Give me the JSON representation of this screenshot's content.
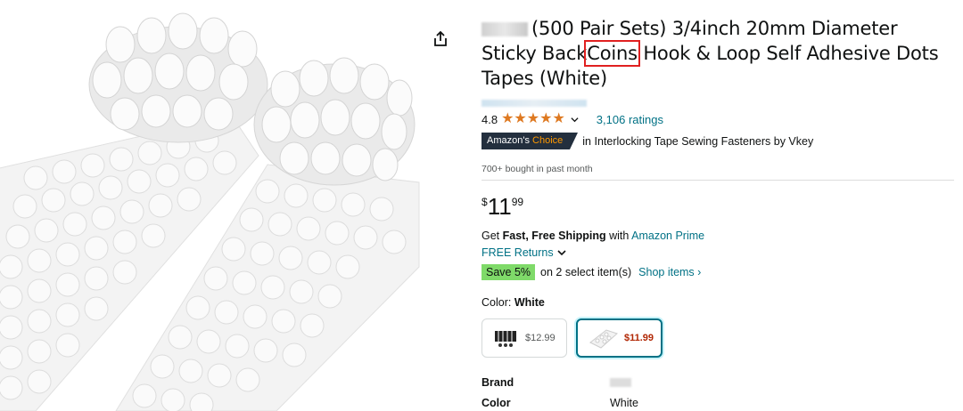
{
  "product": {
    "title": "(500 Pair Sets) 3/4inch 20mm Diameter Sticky Back",
    "title_highlight": "Coins",
    "title_rest": "Hook & Loop Self Adhesive Dots Tapes (White)",
    "rating": "4.8",
    "ratings_count": "3,106 ratings",
    "choice_badge_prefix": "Amazon's",
    "choice_badge_suffix": "Choice",
    "choice_category": "in Interlocking Tape Sewing Fasteners by Vkey",
    "bought": "700+ bought in past month",
    "price_symbol": "$",
    "price_whole": "11",
    "price_fraction": "99"
  },
  "shipping": {
    "prefix": "Get ",
    "bold": "Fast, Free Shipping",
    "middle": " with ",
    "link": "Amazon Prime",
    "returns": "FREE Returns"
  },
  "promo": {
    "badge": "Save 5%",
    "text": "on 2 select item(s)",
    "link": "Shop items ›"
  },
  "color": {
    "label": "Color:",
    "selected": "White",
    "options": [
      {
        "price": "$12.99"
      },
      {
        "price": "$11.99"
      }
    ]
  },
  "specs": [
    {
      "label": "Brand",
      "value": ""
    },
    {
      "label": "Color",
      "value": "White"
    }
  ],
  "colors": {
    "star": "#de7921",
    "link": "#007185",
    "price_red": "#b12704",
    "save_green": "#7fda69",
    "badge_dark": "#232f3e",
    "highlight_box": "#e02020"
  }
}
